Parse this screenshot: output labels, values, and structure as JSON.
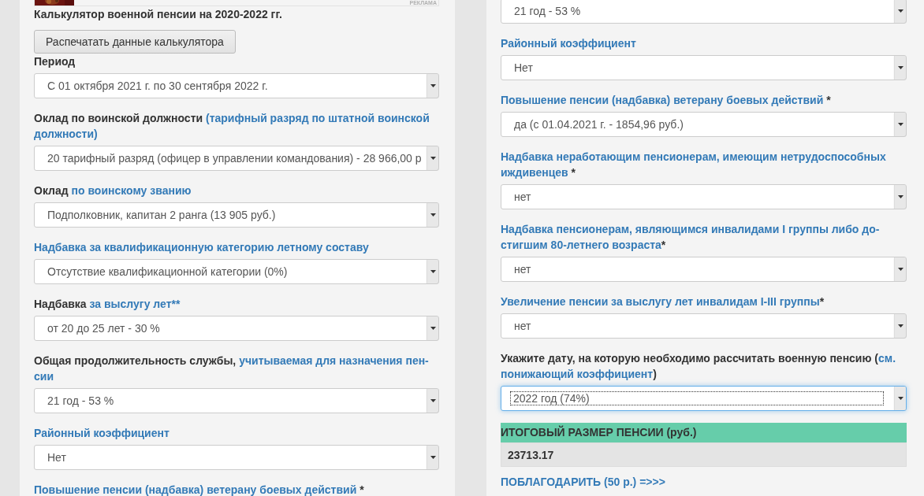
{
  "left": {
    "ad": {
      "label": "РЕКЛАМА"
    },
    "title": "Калькулятор военной пенсии на 2020-2022 гг.",
    "print_button": "Распечатать данные калькулятора",
    "fields": [
      {
        "label": [
          {
            "text": "Период",
            "kind": "text"
          }
        ],
        "value": "С 01 октября 2021 г. по 30 сентября 2022 г.",
        "focused": false
      },
      {
        "label": [
          {
            "text": "Оклад по воинской должности",
            "kind": "text"
          },
          {
            "text": "(тарифный разряд по штатной воинской",
            "kind": "link"
          },
          {
            "text": "должности)",
            "kind": "link"
          }
        ],
        "value": "20 тарифный разряд (офицер в управлении командования) - 28 966,00 р",
        "focused": false
      },
      {
        "label": [
          {
            "text": "Оклад",
            "kind": "text"
          },
          {
            "text": "по воинскому званию",
            "kind": "link"
          }
        ],
        "value": "Подполковник, капитан 2 ранга (13 905 руб.)",
        "focused": false
      },
      {
        "label": [
          {
            "text": "Надбавка за квалификационную категорию летному составу",
            "kind": "link"
          }
        ],
        "value": "Отсутствие квалификационной категории (0%)",
        "focused": false
      },
      {
        "label": [
          {
            "text": "Надбавка",
            "kind": "text"
          },
          {
            "text": "за выслугу лет**",
            "kind": "link"
          }
        ],
        "value": "от 20 до 25 лет - 30 %",
        "focused": false
      },
      {
        "label": [
          {
            "text": "Общая продолжительность службы,",
            "kind": "text"
          },
          {
            "text": "учитываемая для назначения пен-",
            "kind": "link"
          },
          {
            "text": "сии",
            "kind": "link"
          }
        ],
        "value": "21 год - 53 %",
        "focused": false
      },
      {
        "label": [
          {
            "text": "Районный коэффициент",
            "kind": "link"
          }
        ],
        "value": "Нет",
        "focused": false
      },
      {
        "label": [
          {
            "text": "Повышение пенсии (надбавка) ветерану боевых действий",
            "kind": "link"
          },
          {
            "text": "*",
            "kind": "text"
          }
        ]
      }
    ]
  },
  "right": {
    "fields": [
      {
        "value": "21 год - 53 %",
        "focused": false
      },
      {
        "label": [
          {
            "text": "Районный коэффициент",
            "kind": "link"
          }
        ],
        "value": "Нет",
        "focused": false
      },
      {
        "label": [
          {
            "text": "Повышение пенсии (надбавка) ветерану боевых действий",
            "kind": "link"
          },
          {
            "text": "*",
            "kind": "text"
          }
        ],
        "value": "да (с 01.04.2021 г. - 1854,96 руб.)",
        "focused": false
      },
      {
        "label": [
          {
            "text": "Надбавка неработающим пенсионерам, имеющим нетрудоспособных",
            "kind": "link"
          },
          {
            "text": "иждивенцев",
            "kind": "link"
          },
          {
            "text": "*",
            "kind": "text"
          }
        ],
        "value": "нет",
        "focused": false
      },
      {
        "label": [
          {
            "text": "Надбавка пенсионерам, являющимся инвалидами I группы либо до-",
            "kind": "link"
          },
          {
            "text": "стигшим 80-летнего возраста",
            "kind": "link"
          },
          {
            "text": "*",
            "kind": "suffix"
          }
        ],
        "value": "нет",
        "focused": false
      },
      {
        "label": [
          {
            "text": "Увеличение пенсии за выслугу лет инвалидам I-III группы",
            "kind": "link"
          },
          {
            "text": "*",
            "kind": "suffix"
          }
        ],
        "value": "нет",
        "focused": false
      },
      {
        "label": [
          {
            "text": "Укажите дату, на которую необходимо рассчитать военную пенсию (",
            "kind": "text"
          },
          {
            "text": "см.",
            "kind": "link",
            "attached": true
          },
          {
            "text": "понижающий коэффициент",
            "kind": "link"
          },
          {
            "text": ")",
            "kind": "text",
            "attached": true
          }
        ],
        "value": "2022 год (74%)",
        "focused": true
      }
    ],
    "result": {
      "header": "ИТОГОВЫЙ РАЗМЕР ПЕНСИИ (руб.)",
      "value": "23713.17"
    },
    "thanks_link": "ПОБЛАГОДАРИТЬ (50 р.) =>>>"
  }
}
